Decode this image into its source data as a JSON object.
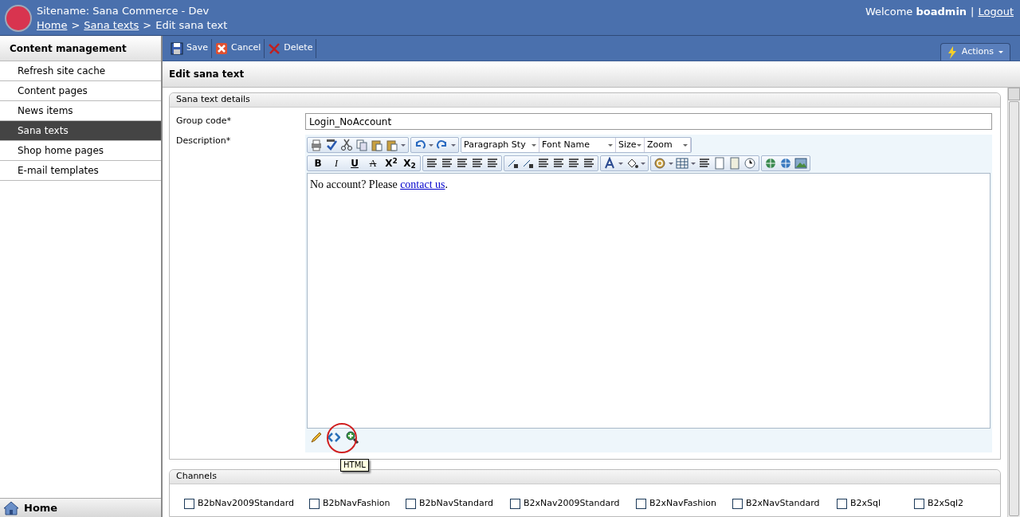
{
  "header": {
    "site_name": "Sitename: Sana Commerce - Dev",
    "breadcrumb": [
      {
        "label": "Home",
        "link": true
      },
      {
        "label": "Sana texts",
        "link": true
      },
      {
        "label": "Edit sana text",
        "link": false
      }
    ],
    "separator": ">",
    "welcome": "Welcome",
    "user": "boadmin",
    "divider": "|",
    "logout": "Logout"
  },
  "sidebar": {
    "title": "Content management",
    "items": [
      {
        "label": "Refresh site cache",
        "selected": false
      },
      {
        "label": "Content pages",
        "selected": false
      },
      {
        "label": "News items",
        "selected": false
      },
      {
        "label": "Sana texts",
        "selected": true
      },
      {
        "label": "Shop home pages",
        "selected": false
      },
      {
        "label": "E-mail templates",
        "selected": false
      }
    ],
    "footer": "Home"
  },
  "toolbar": {
    "buttons": [
      {
        "label": "Save",
        "kind": "save"
      },
      {
        "label": "Cancel",
        "kind": "cancel"
      },
      {
        "label": "Delete",
        "kind": "delete"
      }
    ],
    "actions": "Actions"
  },
  "page_title": "Edit sana text",
  "details": {
    "title": "Sana text details",
    "group_code_label": "Group code*",
    "group_code": "Login_NoAccount",
    "description_label": "Description*",
    "editor": {
      "dropdowns": [
        "Paragraph Sty",
        "Font Name",
        "Size",
        "Zoom"
      ],
      "format_glyphs": [
        "B",
        "I",
        "U",
        "A",
        "X$^{2}$",
        "X$_{2}$"
      ],
      "content": {
        "before": "No account? Please ",
        "link": "contact us",
        "after": "."
      },
      "tooltip": "HTML"
    }
  },
  "channels": {
    "title": "Channels",
    "items": [
      {
        "label": "B2bNav2009Standard",
        "checked": false
      },
      {
        "label": "B2bNavFashion",
        "checked": false
      },
      {
        "label": "B2bNavStandard",
        "checked": false
      },
      {
        "label": "B2xNav2009Standard",
        "checked": false
      },
      {
        "label": "B2xNavFashion",
        "checked": false
      },
      {
        "label": "B2xNavStandard",
        "checked": false
      },
      {
        "label": "B2xSql",
        "checked": false
      },
      {
        "label": "B2xSql2",
        "checked": false
      }
    ]
  }
}
